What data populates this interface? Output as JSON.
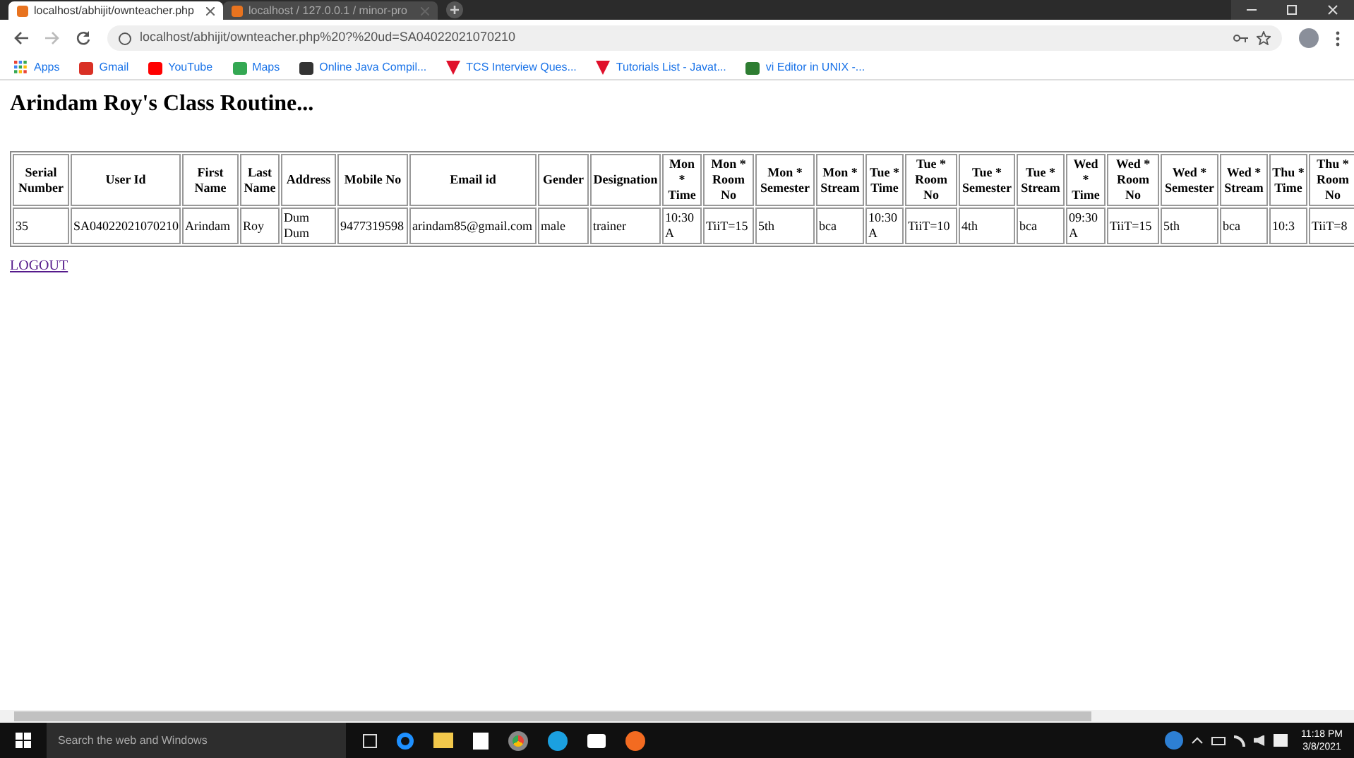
{
  "browser": {
    "tabs": [
      {
        "title": "localhost/abhijit/ownteacher.php",
        "selected": true
      },
      {
        "title": "localhost / 127.0.0.1 / minor-pro",
        "selected": false
      }
    ],
    "address": "localhost/abhijit/ownteacher.php%20?%20ud=SA04022021070210",
    "bookmarks": [
      {
        "label": "Apps"
      },
      {
        "label": "Gmail"
      },
      {
        "label": "YouTube"
      },
      {
        "label": "Maps"
      },
      {
        "label": "Online Java Compil..."
      },
      {
        "label": "TCS Interview Ques..."
      },
      {
        "label": "Tutorials List - Javat..."
      },
      {
        "label": "vi Editor in UNIX -..."
      }
    ]
  },
  "page": {
    "heading": "Arindam Roy's Class Routine...",
    "table": {
      "columns": [
        "Serial Number",
        "User Id",
        "First Name",
        "Last Name",
        "Address",
        "Mobile No",
        "Email id",
        "Gender",
        "Designation",
        "Mon * Time",
        "Mon * Room No",
        "Mon * Semester",
        "Mon * Stream",
        "Tue * Time",
        "Tue * Room No",
        "Tue * Semester",
        "Tue * Stream",
        "Wed * Time",
        "Wed * Room No",
        "Wed * Semester",
        "Wed * Stream",
        "Thu * Time",
        "Thu * Room No"
      ],
      "rows": [
        [
          "35",
          "SA04022021070210",
          "Arindam",
          "Roy",
          "Dum Dum",
          "9477319598",
          "arindam85@gmail.com",
          "male",
          "trainer",
          "10:30 A",
          "TiiT=15",
          "5th",
          "bca",
          "10:30 A",
          "TiiT=10",
          "4th",
          "bca",
          "09:30 A",
          "TiiT=15",
          "5th",
          "bca",
          "10:3",
          "TiiT=8"
        ]
      ]
    },
    "logout": "LOGOUT"
  },
  "taskbar": {
    "search_placeholder": "Search the web and Windows",
    "time": "11:18 PM",
    "date": "3/8/2021"
  }
}
